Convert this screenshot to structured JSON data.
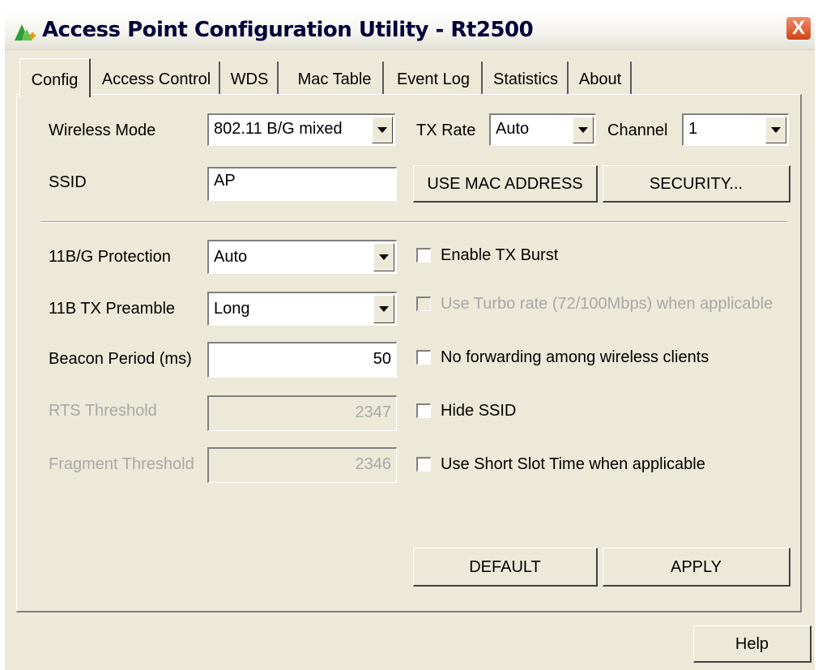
{
  "window": {
    "title": "Access Point Configuration Utility - Rt2500",
    "close_label": "X"
  },
  "tabs": [
    "Config",
    "Access Control",
    "WDS",
    "Mac Table",
    "Event Log",
    "Statistics",
    "About"
  ],
  "config": {
    "wireless_mode": {
      "label": "Wireless Mode",
      "value": "802.11 B/G mixed"
    },
    "tx_rate": {
      "label": "TX Rate",
      "value": "Auto"
    },
    "channel": {
      "label": "Channel",
      "value": "1"
    },
    "ssid": {
      "label": "SSID",
      "value": "AP"
    },
    "use_mac_address_label": "USE MAC ADDRESS",
    "security_label": "SECURITY...",
    "protection": {
      "label": "11B/G Protection",
      "value": "Auto"
    },
    "preamble": {
      "label": "11B TX Preamble",
      "value": "Long"
    },
    "beacon_period": {
      "label": "Beacon Period (ms)",
      "value": "50"
    },
    "rts_threshold": {
      "label": "RTS Threshold",
      "value": "2347"
    },
    "fragment_threshold": {
      "label": "Fragment Threshold",
      "value": "2346"
    },
    "checkboxes": {
      "tx_burst": {
        "label": "Enable TX Burst",
        "checked": false,
        "enabled": true
      },
      "turbo_rate": {
        "label": "Use Turbo rate (72/100Mbps)  when applicable",
        "checked": false,
        "enabled": false
      },
      "no_forwarding": {
        "label": "No forwarding among wireless clients",
        "checked": false,
        "enabled": true
      },
      "hide_ssid": {
        "label": "Hide SSID",
        "checked": false,
        "enabled": true
      },
      "short_slot": {
        "label": "Use Short Slot Time when applicable",
        "checked": false,
        "enabled": true
      }
    },
    "default_label": "DEFAULT",
    "apply_label": "APPLY"
  },
  "help_label": "Help"
}
